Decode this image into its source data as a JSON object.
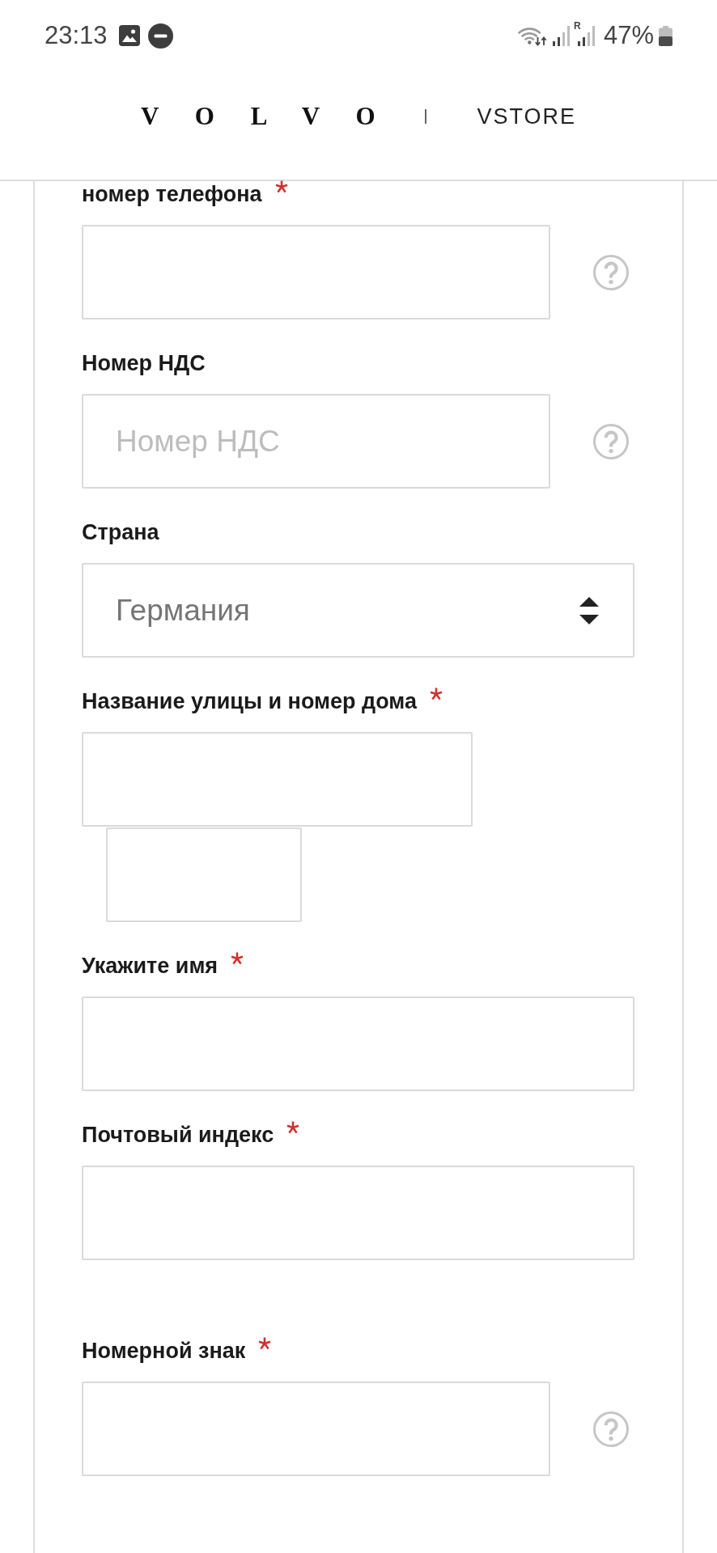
{
  "status_bar": {
    "time": "23:13",
    "roaming": "R",
    "battery": "47%"
  },
  "header": {
    "brand": "VOLVO",
    "store": "VSTORE"
  },
  "form": {
    "sections": [
      {
        "fields": [
          {
            "kind": "input",
            "label": "номер телефона",
            "required": true,
            "help": true
          },
          {
            "kind": "input",
            "label": "Номер НДС",
            "required": false,
            "help": true,
            "placeholder": "Номер НДС"
          },
          {
            "kind": "select",
            "label": "Страна",
            "required": false,
            "help": false,
            "value": "Германия"
          },
          {
            "kind": "address",
            "label": "Название улицы и номер дома",
            "required": true,
            "help": false
          },
          {
            "kind": "input",
            "label": "Укажите имя",
            "required": true,
            "help": false
          },
          {
            "kind": "input",
            "label": "Почтовый индекс",
            "required": true,
            "help": false
          }
        ]
      },
      {
        "fields": [
          {
            "kind": "input",
            "label": "Номерной знак",
            "required": true,
            "help": true
          }
        ]
      }
    ]
  }
}
